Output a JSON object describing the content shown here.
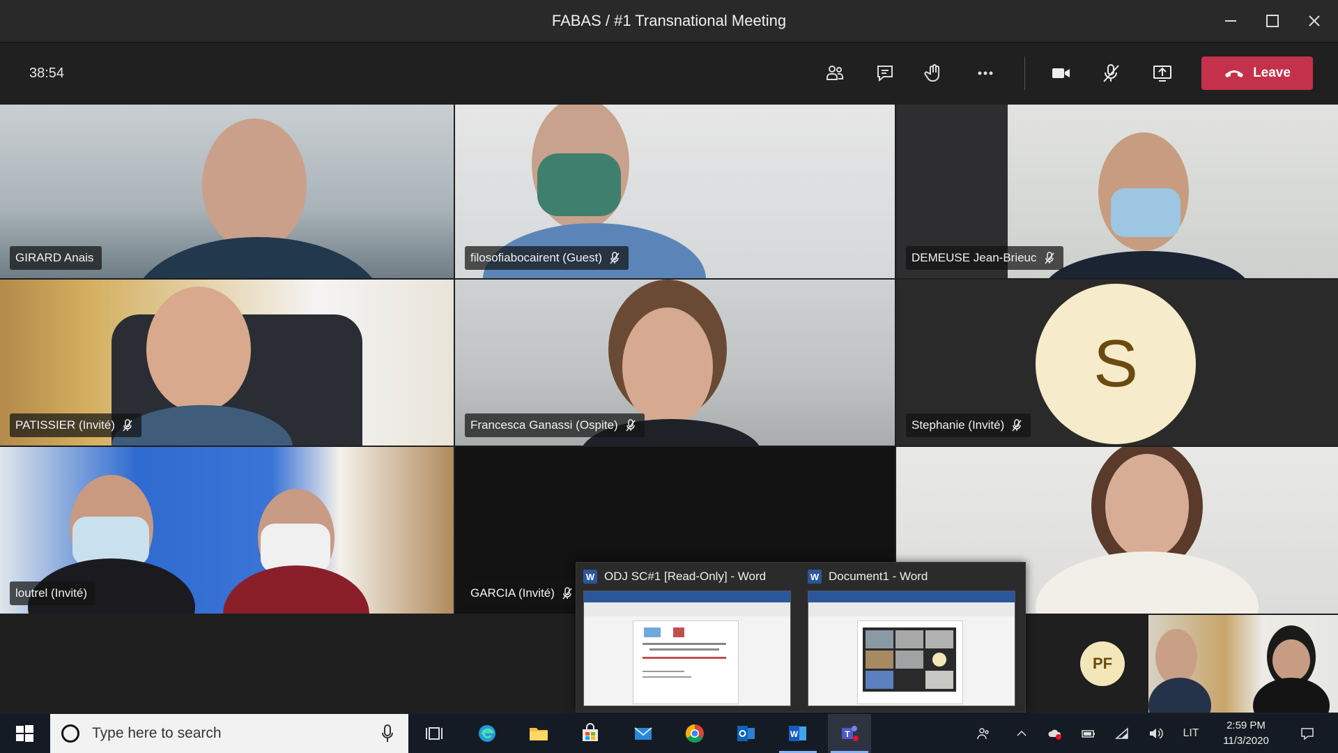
{
  "window": {
    "title": "FABAS / #1 Transnational Meeting"
  },
  "toolbar": {
    "timer": "38:54",
    "leave_label": "Leave"
  },
  "participants": [
    {
      "name": "GIRARD Anais"
    },
    {
      "name": "filosofiabocairent (Guest)"
    },
    {
      "name": "DEMEUSE Jean-Brieuc"
    },
    {
      "name": "PATISSIER (Invité)"
    },
    {
      "name": "Francesca Ganassi (Ospite)"
    },
    {
      "name": "Stephanie (Invité)",
      "initial": "S"
    },
    {
      "name": "loutrel (Invité)"
    },
    {
      "name": "GARCIA (Invité)"
    },
    {
      "name": ""
    }
  ],
  "bottom_strip": {
    "avatar_initials": "PF"
  },
  "taskbar_popup": {
    "windows": [
      {
        "title": "ODJ SC#1 [Read-Only] - Word"
      },
      {
        "title": "Document1 - Word"
      }
    ]
  },
  "taskbar": {
    "search_placeholder": "Type here to search",
    "language": "LIT",
    "time": "2:59 PM",
    "date": "11/3/2020"
  },
  "colors": {
    "leave": "#c4314b",
    "taskbar": "#151b24",
    "word": "#2b579a"
  }
}
